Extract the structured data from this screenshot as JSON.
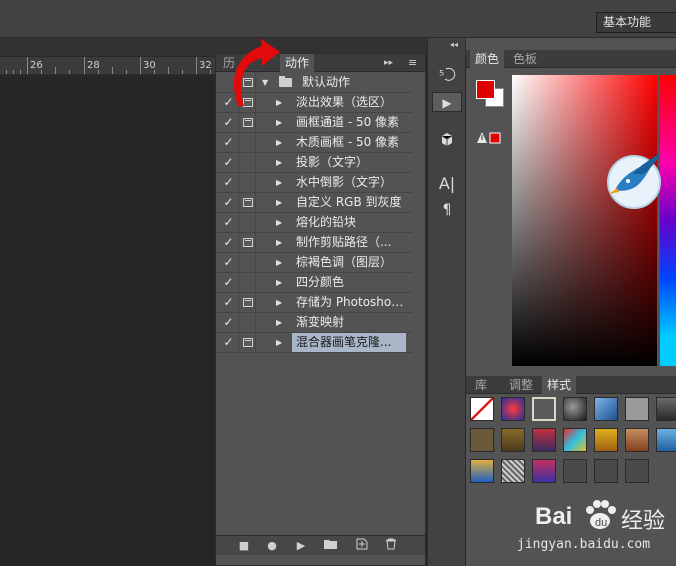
{
  "appbar": {
    "workspace": "基本功能"
  },
  "ruler": {
    "numbers": [
      "26",
      "28",
      "30",
      "32"
    ]
  },
  "actions_panel": {
    "tabs": [
      {
        "label": "历",
        "active": false
      },
      {
        "label": "动作",
        "active": true
      }
    ],
    "menu_glyph": "≡",
    "collapse_glyph": "▸▸",
    "items": [
      {
        "label": "默认动作",
        "checked": false,
        "dialog": true,
        "expanded": true,
        "folder": true,
        "selected": false
      },
      {
        "label": "淡出效果（选区）",
        "checked": true,
        "dialog": true,
        "expanded": false,
        "folder": false,
        "selected": false
      },
      {
        "label": "画框通道 - 50 像素",
        "checked": true,
        "dialog": true,
        "expanded": false,
        "folder": false,
        "selected": false
      },
      {
        "label": "木质画框 - 50 像素",
        "checked": true,
        "dialog": false,
        "expanded": false,
        "folder": false,
        "selected": false
      },
      {
        "label": "投影（文字）",
        "checked": true,
        "dialog": false,
        "expanded": false,
        "folder": false,
        "selected": false
      },
      {
        "label": "水中倒影（文字）",
        "checked": true,
        "dialog": false,
        "expanded": false,
        "folder": false,
        "selected": false
      },
      {
        "label": "自定义 RGB 到灰度",
        "checked": true,
        "dialog": true,
        "expanded": false,
        "folder": false,
        "selected": false
      },
      {
        "label": "熔化的铅块",
        "checked": true,
        "dialog": false,
        "expanded": false,
        "folder": false,
        "selected": false
      },
      {
        "label": "制作剪贴路径（...",
        "checked": true,
        "dialog": true,
        "expanded": false,
        "folder": false,
        "selected": false
      },
      {
        "label": "棕褐色调（图层）",
        "checked": true,
        "dialog": false,
        "expanded": false,
        "folder": false,
        "selected": false
      },
      {
        "label": "四分颜色",
        "checked": true,
        "dialog": false,
        "expanded": false,
        "folder": false,
        "selected": false
      },
      {
        "label": "存储为 Photoshop...",
        "checked": true,
        "dialog": true,
        "expanded": false,
        "folder": false,
        "selected": false
      },
      {
        "label": "渐变映射",
        "checked": true,
        "dialog": false,
        "expanded": false,
        "folder": false,
        "selected": false
      },
      {
        "label": "混合器画笔克隆...",
        "checked": true,
        "dialog": true,
        "expanded": false,
        "folder": false,
        "selected": true
      }
    ],
    "bottom_buttons": [
      "stop-icon",
      "record-icon",
      "play-icon",
      "folder-icon",
      "new-action-icon",
      "trash-icon"
    ]
  },
  "mid_toolbar": {
    "buttons": [
      "history-brush-icon",
      "play-icon",
      "cube-icon",
      "text-icon",
      "paragraph-icon"
    ]
  },
  "color_panel": {
    "tabs": [
      {
        "label": "颜色",
        "active": true
      },
      {
        "label": "色板",
        "active": false
      }
    ],
    "foreground": "#e10000",
    "background": "#ffffff"
  },
  "styles_panel": {
    "tabs": [
      {
        "label": "库",
        "active": false
      },
      {
        "label": "调整",
        "active": false
      },
      {
        "label": "样式",
        "active": true
      }
    ]
  },
  "watermark": {
    "brand_prefix": "Bai",
    "brand_suffix": "经验",
    "url": "jingyan.baidu.com"
  }
}
